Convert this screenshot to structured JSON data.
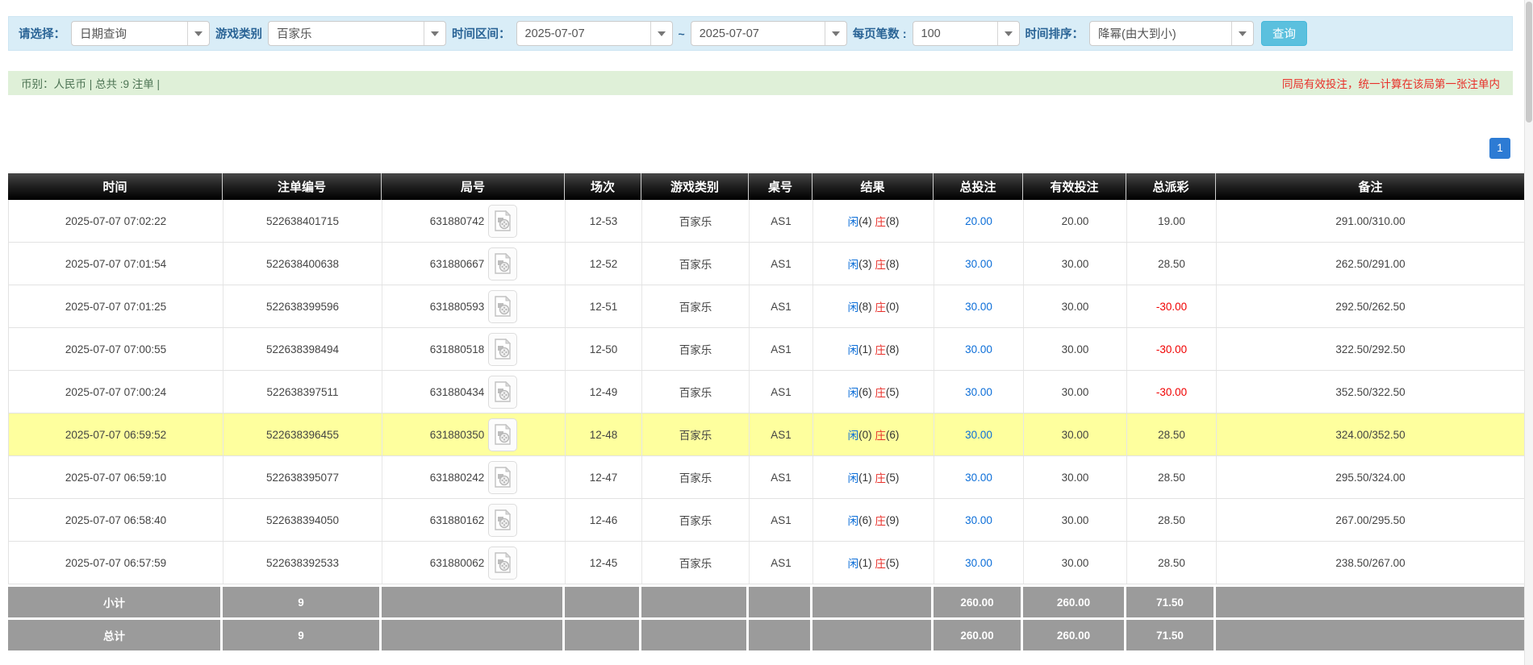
{
  "filters": {
    "select_label": "请选择：",
    "query_type": "日期查询",
    "game_category_label": "游戏类别",
    "game_category": "百家乐",
    "time_range_label": "时间区间：",
    "date_from": "2025-07-07",
    "tilde": "~",
    "date_to": "2025-07-07",
    "per_page_label": "每页笔数 :",
    "per_page": "100",
    "sort_label": "时间排序：",
    "sort_order": "降幂(由大到小)",
    "search_button": "查询"
  },
  "summary": {
    "left_text": "币别：人民币 | 总共 :9 注单 |",
    "right_note": "同局有效投注，统一计算在该局第一张注单内"
  },
  "pagination": {
    "current": "1"
  },
  "table": {
    "headers": [
      "时间",
      "注单编号",
      "局号",
      "场次",
      "游戏类别",
      "桌号",
      "结果",
      "总投注",
      "有效投注",
      "总派彩",
      "备注"
    ],
    "rows": [
      {
        "time": "2025-07-07 07:02:22",
        "bet_id": "522638401715",
        "round_id": "631880742",
        "session": "12-53",
        "game": "百家乐",
        "table_no": "AS1",
        "player_label": "闲",
        "player_score": "(4)",
        "banker_label": "庄",
        "banker_score": "(8)",
        "total_bet": "20.00",
        "valid_bet": "20.00",
        "payout": "19.00",
        "note": "291.00/310.00",
        "highlighted": false
      },
      {
        "time": "2025-07-07 07:01:54",
        "bet_id": "522638400638",
        "round_id": "631880667",
        "session": "12-52",
        "game": "百家乐",
        "table_no": "AS1",
        "player_label": "闲",
        "player_score": "(3)",
        "banker_label": "庄",
        "banker_score": "(8)",
        "total_bet": "30.00",
        "valid_bet": "30.00",
        "payout": "28.50",
        "note": "262.50/291.00",
        "highlighted": false
      },
      {
        "time": "2025-07-07 07:01:25",
        "bet_id": "522638399596",
        "round_id": "631880593",
        "session": "12-51",
        "game": "百家乐",
        "table_no": "AS1",
        "player_label": "闲",
        "player_score": "(8)",
        "banker_label": "庄",
        "banker_score": "(0)",
        "total_bet": "30.00",
        "valid_bet": "30.00",
        "payout": "-30.00",
        "note": "292.50/262.50",
        "highlighted": false
      },
      {
        "time": "2025-07-07 07:00:55",
        "bet_id": "522638398494",
        "round_id": "631880518",
        "session": "12-50",
        "game": "百家乐",
        "table_no": "AS1",
        "player_label": "闲",
        "player_score": "(1)",
        "banker_label": "庄",
        "banker_score": "(8)",
        "total_bet": "30.00",
        "valid_bet": "30.00",
        "payout": "-30.00",
        "note": "322.50/292.50",
        "highlighted": false
      },
      {
        "time": "2025-07-07 07:00:24",
        "bet_id": "522638397511",
        "round_id": "631880434",
        "session": "12-49",
        "game": "百家乐",
        "table_no": "AS1",
        "player_label": "闲",
        "player_score": "(6)",
        "banker_label": "庄",
        "banker_score": "(5)",
        "total_bet": "30.00",
        "valid_bet": "30.00",
        "payout": "-30.00",
        "note": "352.50/322.50",
        "highlighted": false
      },
      {
        "time": "2025-07-07 06:59:52",
        "bet_id": "522638396455",
        "round_id": "631880350",
        "session": "12-48",
        "game": "百家乐",
        "table_no": "AS1",
        "player_label": "闲",
        "player_score": "(0)",
        "banker_label": "庄",
        "banker_score": "(6)",
        "total_bet": "30.00",
        "valid_bet": "30.00",
        "payout": "28.50",
        "note": "324.00/352.50",
        "highlighted": true
      },
      {
        "time": "2025-07-07 06:59:10",
        "bet_id": "522638395077",
        "round_id": "631880242",
        "session": "12-47",
        "game": "百家乐",
        "table_no": "AS1",
        "player_label": "闲",
        "player_score": "(1)",
        "banker_label": "庄",
        "banker_score": "(5)",
        "total_bet": "30.00",
        "valid_bet": "30.00",
        "payout": "28.50",
        "note": "295.50/324.00",
        "highlighted": false
      },
      {
        "time": "2025-07-07 06:58:40",
        "bet_id": "522638394050",
        "round_id": "631880162",
        "session": "12-46",
        "game": "百家乐",
        "table_no": "AS1",
        "player_label": "闲",
        "player_score": "(6)",
        "banker_label": "庄",
        "banker_score": "(9)",
        "total_bet": "30.00",
        "valid_bet": "30.00",
        "payout": "28.50",
        "note": "267.00/295.50",
        "highlighted": false
      },
      {
        "time": "2025-07-07 06:57:59",
        "bet_id": "522638392533",
        "round_id": "631880062",
        "session": "12-45",
        "game": "百家乐",
        "table_no": "AS1",
        "player_label": "闲",
        "player_score": "(1)",
        "banker_label": "庄",
        "banker_score": "(5)",
        "total_bet": "30.00",
        "valid_bet": "30.00",
        "payout": "28.50",
        "note": "238.50/267.00",
        "highlighted": false
      }
    ],
    "subtotal_row": {
      "label": "小计",
      "count": "9",
      "total_bet": "260.00",
      "valid_bet": "260.00",
      "payout": "71.50"
    },
    "total_row": {
      "label": "总计",
      "count": "9",
      "total_bet": "260.00",
      "valid_bet": "260.00",
      "payout": "71.50"
    }
  },
  "icons": {
    "dropdown_arrow": "triangle-down",
    "video_record": "document-film-reel"
  },
  "colors": {
    "filter_bar_bg": "#d9edf7",
    "filter_label": "#2a6496",
    "summary_bar_bg": "#dff0d8",
    "summary_text": "#4d7454",
    "note_red": "#e8302a",
    "link_blue": "#0c6ed8",
    "payout_negative_red": "#f00000",
    "header_bg": "#000000",
    "highlight_yellow": "#feff9e",
    "footer_grey": "#9b9b9b",
    "search_button_bg": "#5bc0de",
    "pagination_bg": "#2d7bd4"
  }
}
